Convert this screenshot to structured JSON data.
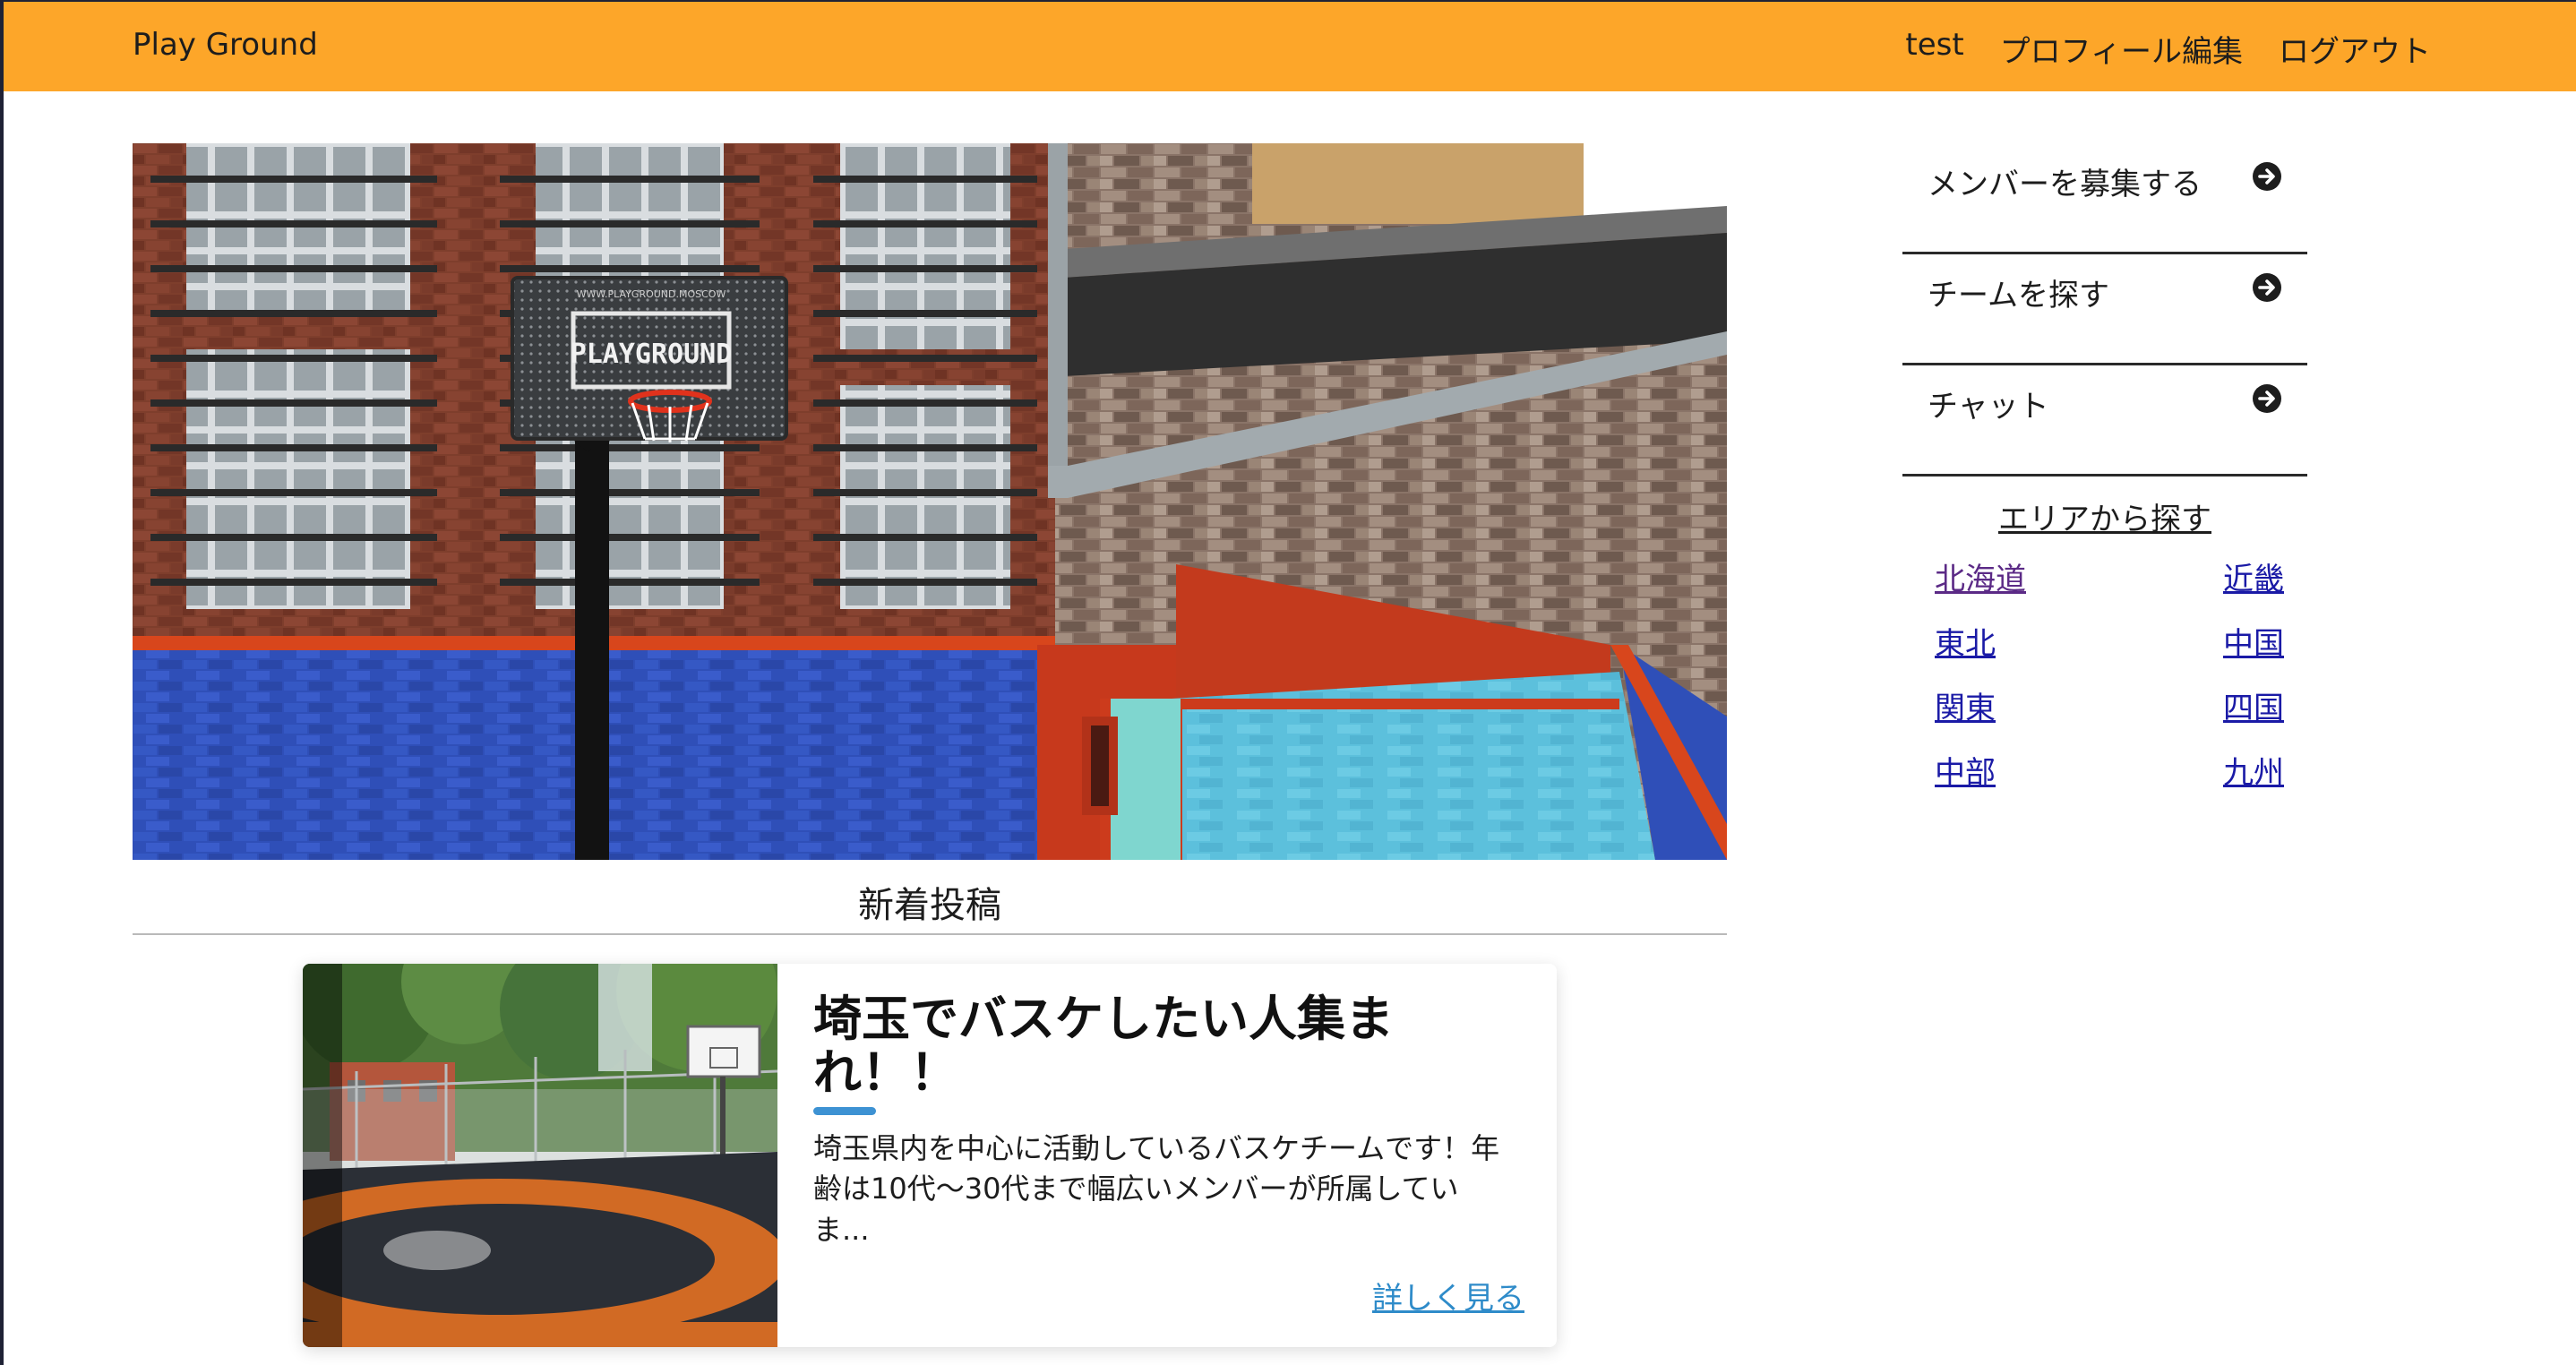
{
  "header": {
    "brand": "Play Ground",
    "links": [
      "test",
      "プロフィール編集",
      "ログアウト"
    ],
    "background_color": "#fda629"
  },
  "hero": {
    "sign_text": "PLAYGROUND",
    "sign_small_text": "WWW.PLAYGROUND.MOSCOW"
  },
  "posts": {
    "section_title": "新着投稿",
    "items": [
      {
        "title": "埼玉でバスケしたい人集まれ！！",
        "body": "埼玉県内を中心に活動しているバスケチームです！年齢は10代〜30代まで幅広いメンバーが所属していま...",
        "more_label": "詳しく見る"
      }
    ]
  },
  "sidebar": {
    "menu": [
      {
        "label": "メンバーを募集する",
        "icon": "arrow-circle-right-icon"
      },
      {
        "label": "チームを探す",
        "icon": "arrow-circle-right-icon"
      },
      {
        "label": "チャット",
        "icon": "arrow-circle-right-icon"
      }
    ],
    "area_title": "エリアから探す",
    "areas": [
      "北海道",
      "近畿",
      "東北",
      "中国",
      "関東",
      "四国",
      "中部",
      "九州"
    ]
  },
  "colors": {
    "link": "#1a1aa6",
    "visited_link": "#5b2a86",
    "accent": "#3d92d3",
    "more_link": "#2e8bc9"
  }
}
